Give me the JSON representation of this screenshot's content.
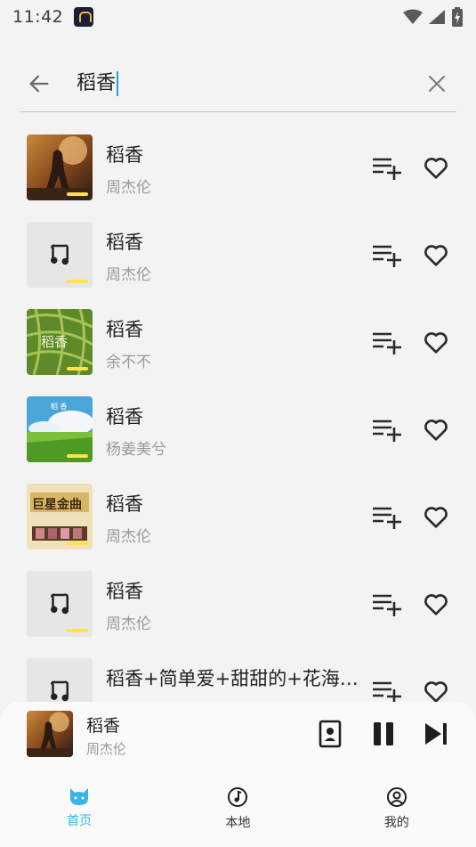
{
  "status_bar": {
    "time": "11:42"
  },
  "search": {
    "query": "稻香"
  },
  "songs": [
    {
      "title": "稻香",
      "artist": "周杰伦",
      "cover": "art-warrior"
    },
    {
      "title": "稻香",
      "artist": "周杰伦",
      "cover": "placeholder"
    },
    {
      "title": "稻香",
      "artist": "余不不",
      "cover": "art-green"
    },
    {
      "title": "稻香",
      "artist": "杨姜美兮",
      "cover": "art-sky"
    },
    {
      "title": "稻香",
      "artist": "周杰伦",
      "cover": "art-gold"
    },
    {
      "title": "稻香",
      "artist": "周杰伦",
      "cover": "placeholder"
    },
    {
      "title": "稻香+简单爱+甜甜的+花海+晴天",
      "artist": "",
      "cover": "placeholder"
    }
  ],
  "cover_texts": {
    "green": "稻香",
    "sky": "稻 香",
    "gold": "巨星金曲"
  },
  "player": {
    "title": "稻香",
    "artist": "周杰伦"
  },
  "nav": [
    {
      "label": "首页",
      "icon": "cat-icon",
      "active": true
    },
    {
      "label": "本地",
      "icon": "music-disc-icon",
      "active": false
    },
    {
      "label": "我的",
      "icon": "profile-icon",
      "active": false
    }
  ],
  "colors": {
    "accent": "#3ab4e6",
    "cover_tag": "#ffe24a",
    "cursor": "#2aa0d6"
  }
}
